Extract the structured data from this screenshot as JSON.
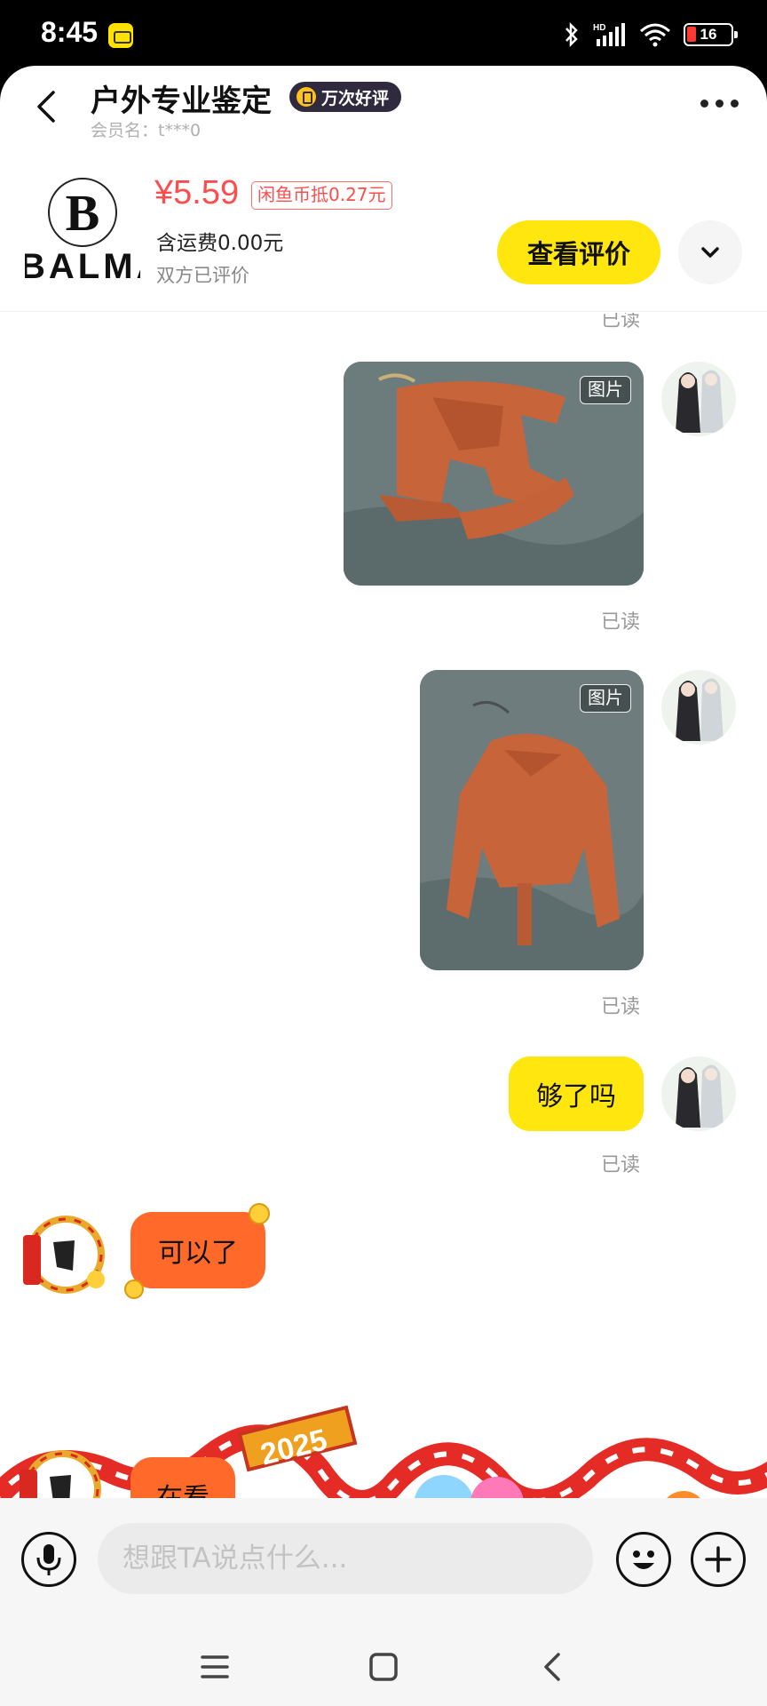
{
  "status_bar": {
    "time": "8:45",
    "battery": "16",
    "icons": [
      "app-notification-icon",
      "bluetooth-icon",
      "signal-icon",
      "wifi-icon",
      "battery-icon"
    ]
  },
  "header": {
    "title": "户外专业鉴定",
    "badge": "万次好评",
    "member_label": "会员名：t***0"
  },
  "product": {
    "logo_letter": "B",
    "logo_text": "BALMAIN",
    "price": "¥5.59",
    "coin_discount": "闲鱼币抵0.27元",
    "shipping": "含运费0.00元",
    "review_status": "双方已评价",
    "view_review_button": "查看评价"
  },
  "messages": [
    {
      "type": "image",
      "from": "me",
      "tag": "图片",
      "status": "已读"
    },
    {
      "type": "image",
      "from": "me",
      "tag": "图片",
      "status": "已读"
    },
    {
      "type": "text",
      "from": "me",
      "text": "够了吗",
      "status": "已读"
    },
    {
      "type": "text",
      "from": "other",
      "text": "可以了"
    },
    {
      "type": "text",
      "from": "other",
      "text": "在看"
    }
  ],
  "top_read_label": "已读",
  "banner": {
    "year": "2025"
  },
  "input": {
    "placeholder": "想跟TA说点什么..."
  },
  "colors": {
    "accent_yellow": "#ffe60f",
    "price_red": "#ff4d4d",
    "bubble_orange": "#ff6a2a"
  }
}
